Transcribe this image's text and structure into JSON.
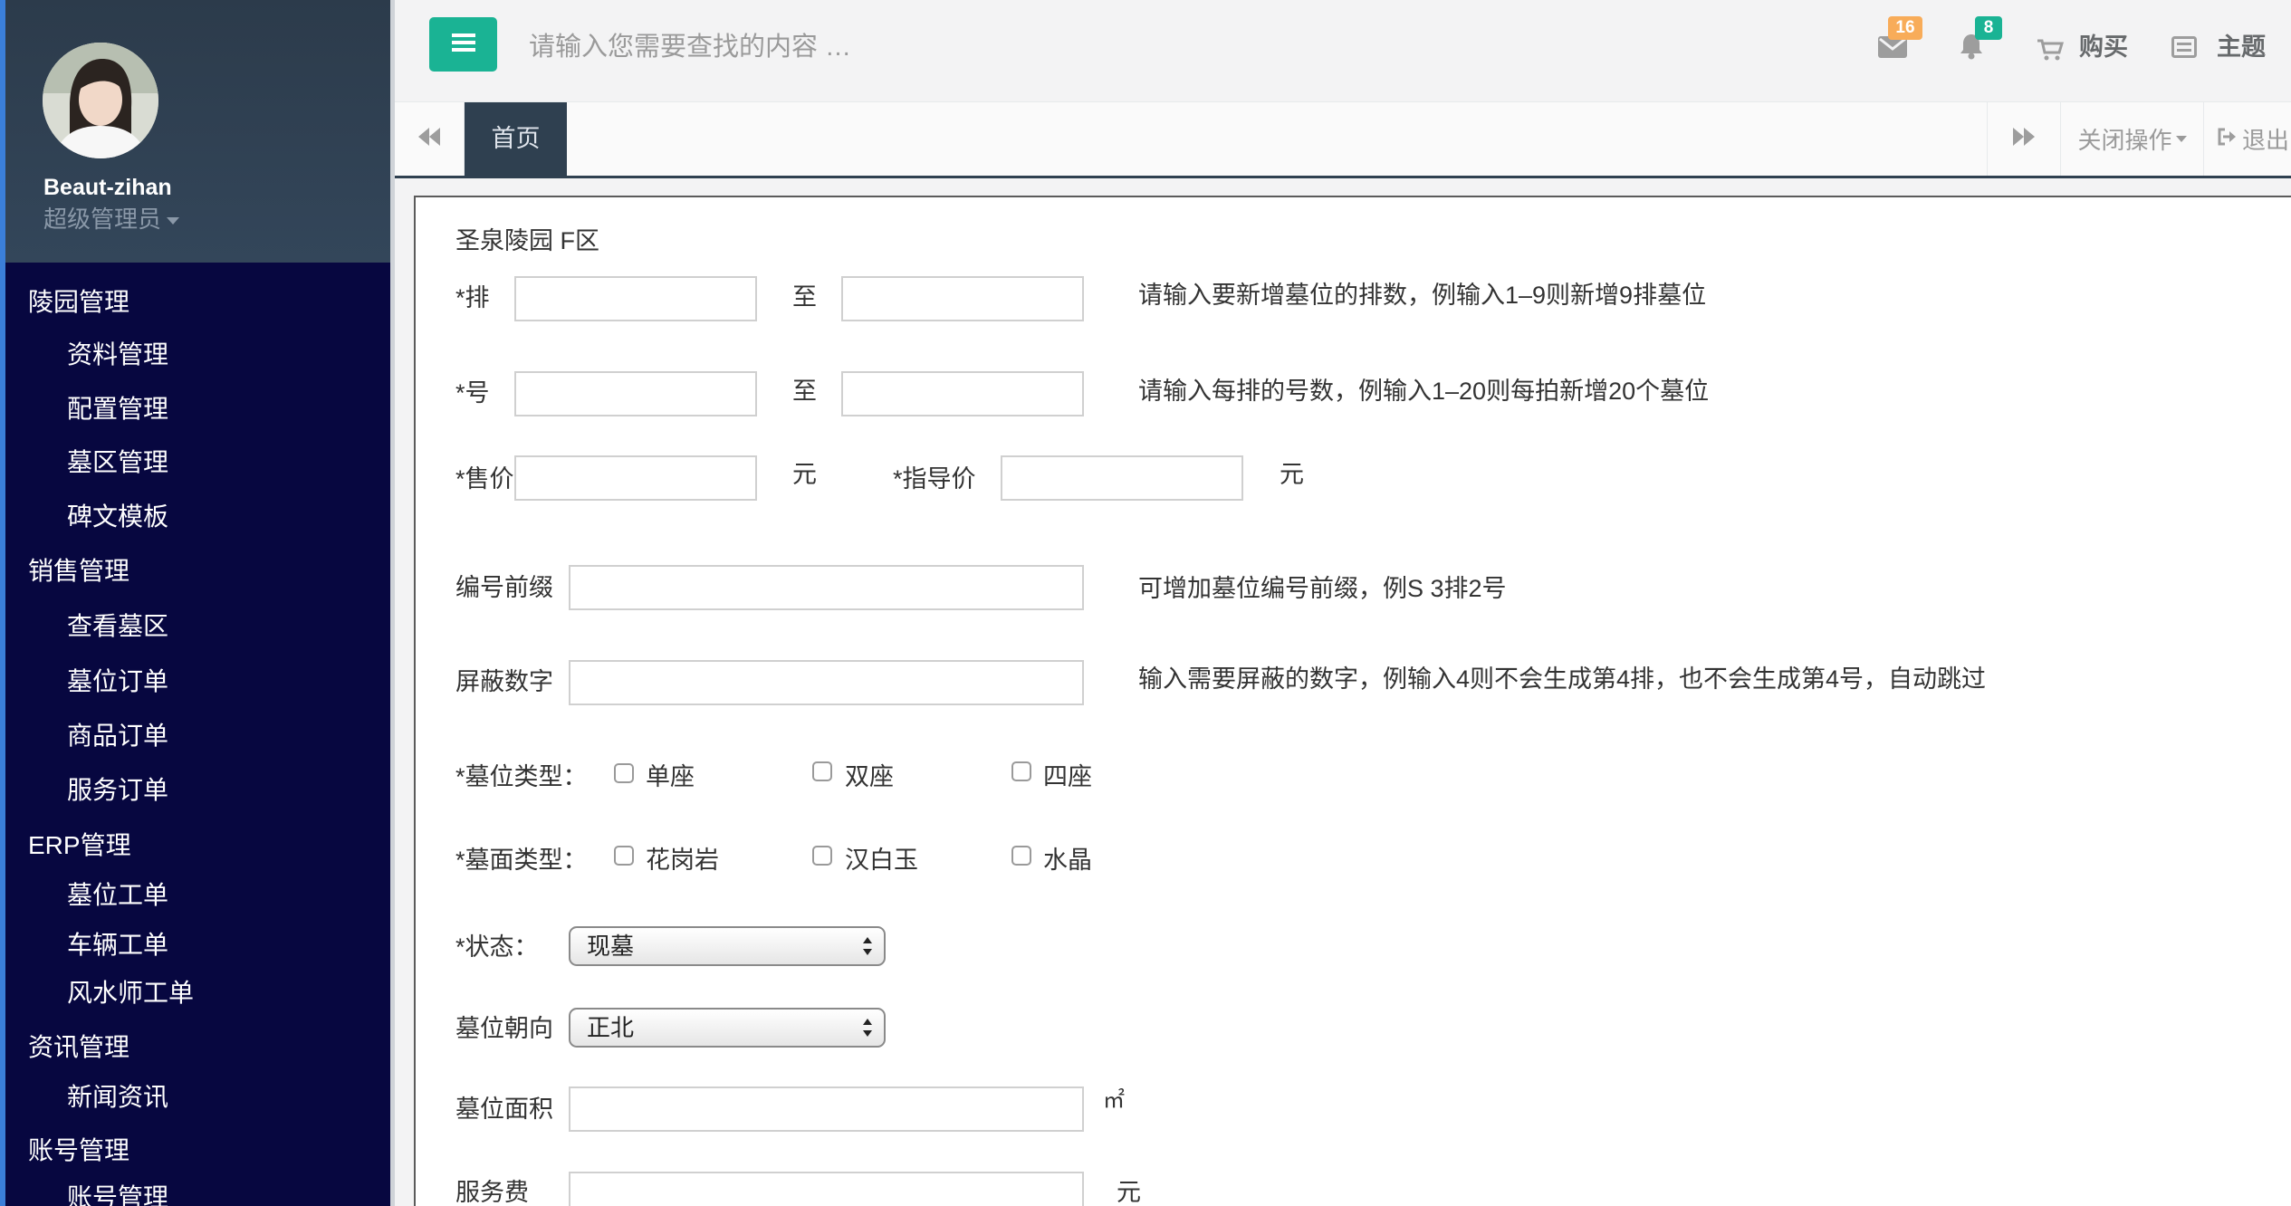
{
  "sidebar": {
    "user": {
      "name": "Beaut-zihan",
      "role": "超级管理员"
    },
    "menu": [
      {
        "label": "陵园管理",
        "children": [
          "资料管理",
          "配置管理",
          "墓区管理",
          "碑文模板"
        ]
      },
      {
        "label": "销售管理",
        "children": [
          "查看墓区",
          "墓位订单",
          "商品订单",
          "服务订单"
        ]
      },
      {
        "label": "ERP管理",
        "children": [
          "墓位工单",
          "车辆工单",
          "风水师工单"
        ]
      },
      {
        "label": "资讯管理",
        "children": [
          "新闻资讯"
        ]
      },
      {
        "label": "账号管理",
        "children": [
          "账号管理"
        ]
      }
    ]
  },
  "topbar": {
    "search_placeholder": "请输入您需要查找的内容 …",
    "mail_count": "16",
    "notification_count": "8",
    "buy_label": "购买",
    "theme_label": "主题"
  },
  "tabs": {
    "items": [
      "首页"
    ],
    "close_label": "关闭操作",
    "logout_label": "退出"
  },
  "form": {
    "title": "圣泉陵园 F区",
    "row_label": "*排",
    "to_label": "至",
    "row_hint": "请输入要新增墓位的排数，例输入1–9则新增9排墓位",
    "number_label": "*号",
    "number_hint": "请输入每排的号数，例输入1–20则每拍新增20个墓位",
    "price_label": "*售价",
    "currency_unit": "元",
    "guide_price_label": "*指导价",
    "prefix_label": "编号前缀",
    "prefix_hint": "可增加墓位编号前缀，例S 3排2号",
    "mask_label": "屏蔽数字",
    "mask_hint": "输入需要屏蔽的数字，例输入4则不会生成第4排，也不会生成第4号，自动跳过",
    "grave_type_label": "*墓位类型：",
    "grave_types": [
      "单座",
      "双座",
      "四座"
    ],
    "surface_type_label": "*墓面类型：",
    "surface_types": [
      "花岗岩",
      "汉白玉",
      "水晶"
    ],
    "status_label": "*状态：",
    "status_value": "现墓",
    "orientation_label": "墓位朝向",
    "orientation_value": "正北",
    "area_label": "墓位面积",
    "area_unit": "㎡",
    "service_fee_label": "服务费",
    "service_fee_unit": "元"
  },
  "icons": {
    "menu_toggle": "hamburger-icon",
    "mail": "envelope-icon",
    "notifications": "bell-icon",
    "buy": "cart-icon",
    "theme": "theme-icon",
    "tab_back": "backward-icon",
    "tab_forward": "forward-icon",
    "logout": "sign-out-icon"
  },
  "colors": {
    "accent": "#1ab394",
    "mail_badge": "#f8ac59",
    "notification_badge": "#1ab394",
    "sidebar_bg": "#070740",
    "profile_bg": "#2f4050",
    "active_tab_bg": "#2f4050"
  }
}
